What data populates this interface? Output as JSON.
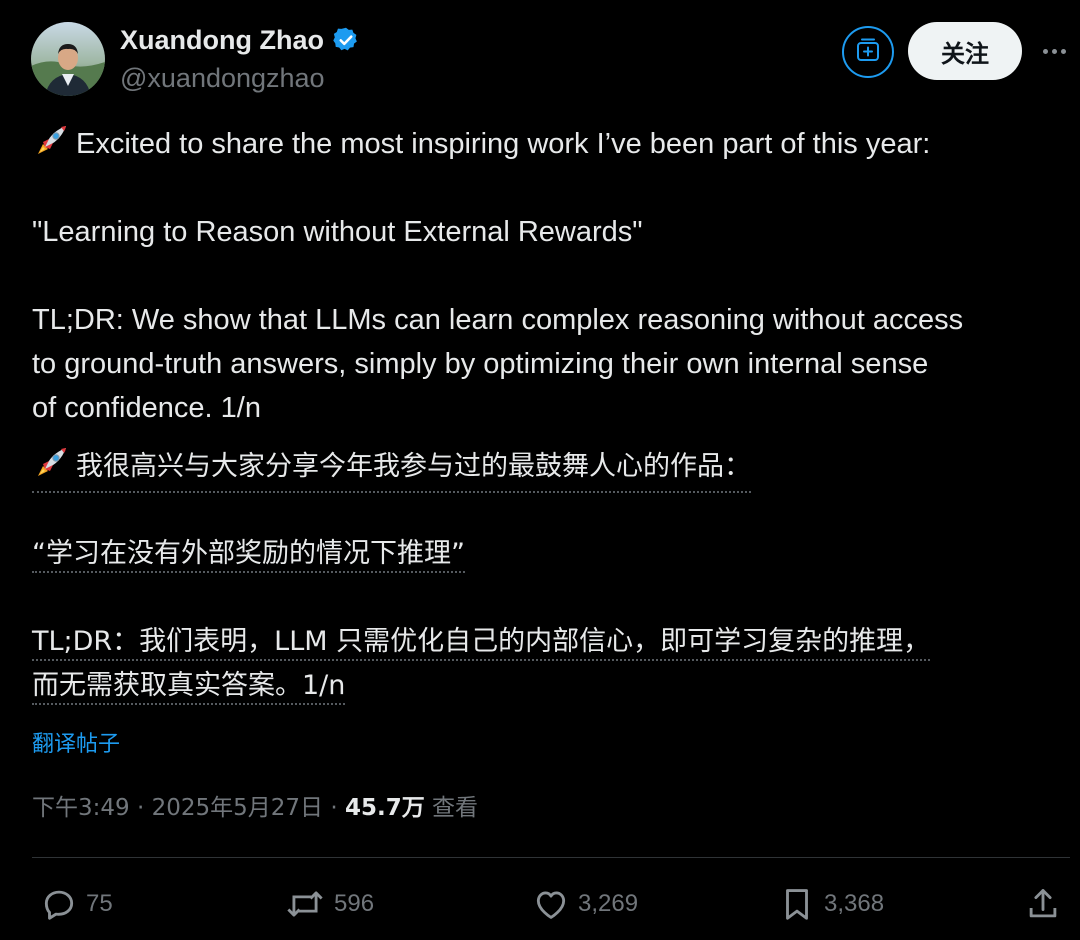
{
  "author": {
    "name": "Xuandong Zhao",
    "handle": "@xuandongzhao",
    "verified": true
  },
  "buttons": {
    "follow_label": "关注"
  },
  "tweet": {
    "en_line1": "Excited to share the most inspiring work I’ve been part of this year:",
    "en_line2": "\"Learning to Reason without External Rewards\"",
    "en_line3": "TL;DR: We show that LLMs can learn complex reasoning without access",
    "en_line4": "to ground-truth answers, simply by optimizing their own internal sense",
    "en_line5": "of confidence. 1/n",
    "zh_line1": "我很高兴与大家分享今年我参与过的最鼓舞人心的作品：",
    "zh_line2": "“学习在没有外部奖励的情况下推理”",
    "zh_line3": "TL;DR：我们表明，LLM 只需优化自己的内部信心，即可学习复杂的推理，",
    "zh_line4": "而无需获取真实答案。1/n"
  },
  "translate_label": "翻译帖子",
  "meta": {
    "time": "下午3:49",
    "date": "2025年5月27日",
    "views_count": "45.7万",
    "views_label": "查看"
  },
  "actions": {
    "replies": "75",
    "reposts": "596",
    "likes": "3,269",
    "bookmarks": "3,368"
  },
  "icons": {
    "rocket": "rocket-icon",
    "verified": "verified-badge-icon",
    "subscribe": "subscribe-icon",
    "more": "more-icon",
    "reply": "reply-icon",
    "repost": "repost-icon",
    "like": "heart-icon",
    "bookmark": "bookmark-icon",
    "share": "share-icon"
  },
  "colors": {
    "background": "#000000",
    "text": "#e7e9ea",
    "muted": "#71767b",
    "accent": "#1d9bf0",
    "follow_bg": "#eff3f4"
  }
}
